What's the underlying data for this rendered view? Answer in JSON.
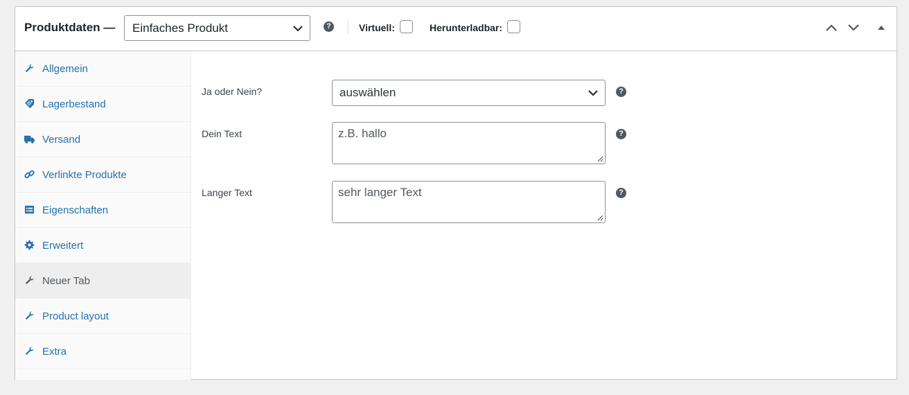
{
  "header": {
    "title": "Produktdaten —",
    "product_type": "Einfaches Produkt",
    "virtual_label": "Virtuell:",
    "downloadable_label": "Herunterladbar:"
  },
  "sidebar": {
    "items": [
      {
        "label": "Allgemein",
        "icon": "wrench-icon"
      },
      {
        "label": "Lagerbestand",
        "icon": "tag-icon"
      },
      {
        "label": "Versand",
        "icon": "truck-icon"
      },
      {
        "label": "Verlinkte Produkte",
        "icon": "link-icon"
      },
      {
        "label": "Eigenschaften",
        "icon": "list-icon"
      },
      {
        "label": "Erweitert",
        "icon": "gear-icon"
      },
      {
        "label": "Neuer Tab",
        "icon": "wrench-icon"
      },
      {
        "label": "Product layout",
        "icon": "wrench-icon"
      },
      {
        "label": "Extra",
        "icon": "wrench-icon"
      }
    ],
    "active": "Neuer Tab"
  },
  "fields": {
    "yes_no": {
      "label": "Ja oder Nein?",
      "value": "auswählen"
    },
    "your_text": {
      "label": "Dein Text",
      "placeholder": "z.B. hallo"
    },
    "long_text": {
      "label": "Langer Text",
      "value": "sehr langer Text"
    }
  },
  "colors": {
    "link": "#2271b1",
    "icon": "#50575e",
    "active_tab_bg": "#eeeeee"
  }
}
